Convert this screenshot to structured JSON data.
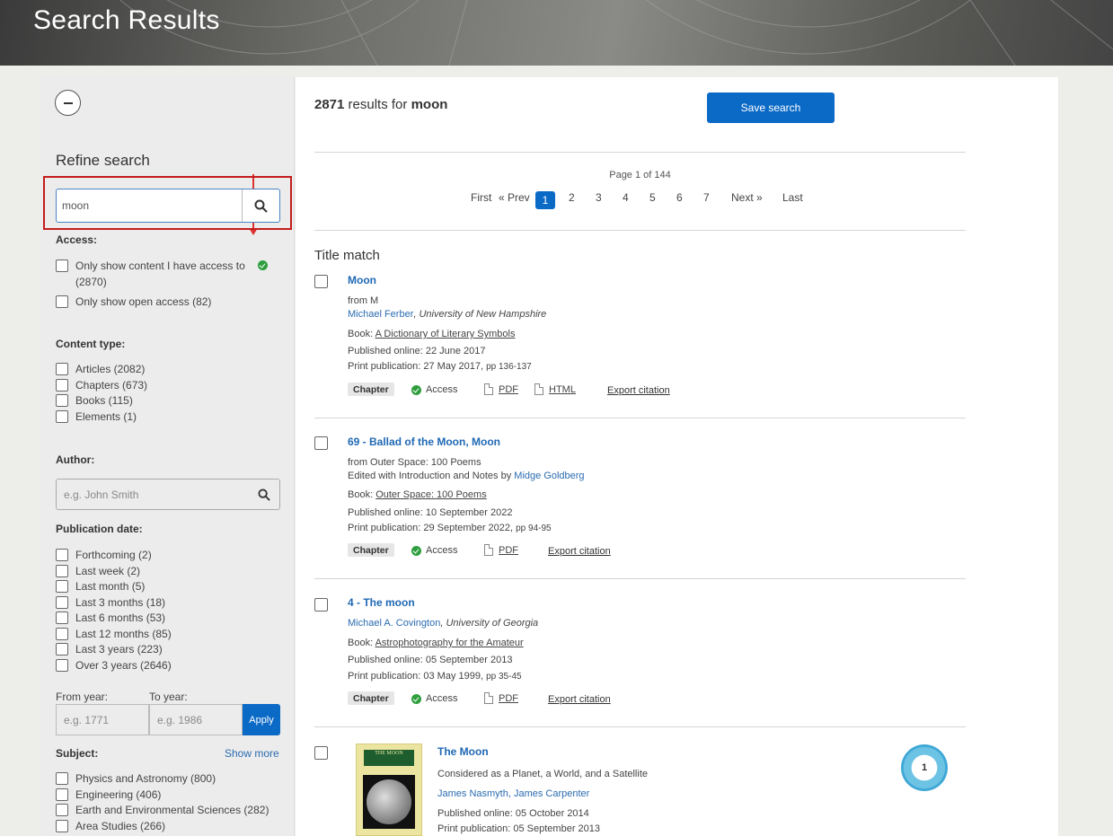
{
  "header": {
    "title": "Search Results"
  },
  "sidebar": {
    "refine_title": "Refine search",
    "search_value": "moon",
    "access": {
      "label": "Access:",
      "options": [
        "Only show content I have access to",
        "(2870)",
        "Only show open access (82)"
      ]
    },
    "content_type": {
      "label": "Content type:",
      "options": [
        "Articles (2082)",
        "Chapters (673)",
        "Books (115)",
        "Elements (1)"
      ]
    },
    "author": {
      "label": "Author:",
      "placeholder": "e.g. John Smith"
    },
    "publication_date": {
      "label": "Publication date:",
      "options": [
        "Forthcoming (2)",
        "Last week (2)",
        "Last month (5)",
        "Last 3 months (18)",
        "Last 6 months (53)",
        "Last 12 months (85)",
        "Last 3 years (223)",
        "Over 3 years (2646)"
      ]
    },
    "from_year": {
      "label": "From year:",
      "placeholder": "e.g. 1771"
    },
    "to_year": {
      "label": "To year:",
      "placeholder": "e.g. 1986"
    },
    "apply_label": "Apply",
    "subject": {
      "label": "Subject:",
      "show_more": "Show more",
      "options": [
        "Physics and Astronomy (800)",
        "Engineering (406)",
        "Earth and Environmental Sciences (282)",
        "Area Studies (266)"
      ]
    }
  },
  "main": {
    "count": "2871",
    "results_for": "results for",
    "query": "moon",
    "save_label": "Save search",
    "page_of": "Page 1 of 144",
    "pager": {
      "first": "First",
      "prev": "« Prev",
      "pages": [
        "1",
        "2",
        "3",
        "4",
        "5",
        "6",
        "7"
      ],
      "next": "Next »",
      "last": "Last"
    },
    "section_title": "Title match",
    "results": [
      {
        "title": "Moon",
        "from": "from M",
        "author": "Michael Ferber",
        "affiliation": ", University of New Hampshire",
        "book_prefix": "Book: ",
        "book": "A Dictionary of Literary Symbols",
        "published": "Published online: 22 June 2017",
        "print": "Print publication: 27 May 2017, ",
        "pages": "pp 136-137",
        "badge": "Chapter",
        "access": "Access",
        "pdf": "PDF",
        "html": "HTML",
        "export": "Export citation"
      },
      {
        "title": "69 - Ballad of the Moon, Moon",
        "from": "from Outer Space: 100 Poems",
        "edited": "Edited with Introduction and Notes by ",
        "editor": "Midge Goldberg",
        "book_prefix": "Book: ",
        "book": "Outer Space: 100 Poems",
        "published": "Published online: 10 September 2022",
        "print": "Print publication: 29 September 2022, ",
        "pages": "pp 94-95",
        "badge": "Chapter",
        "access": "Access",
        "pdf": "PDF",
        "export": "Export citation"
      },
      {
        "title": "4 - The moon",
        "author": "Michael A. Covington",
        "affiliation": ", University of Georgia",
        "book_prefix": "Book: ",
        "book": "Astrophotography for the Amateur",
        "published": "Published online: 05 September 2013",
        "print": "Print publication: 03 May 1999, ",
        "pages": "pp 35-45",
        "badge": "Chapter",
        "access": "Access",
        "pdf": "PDF",
        "export": "Export citation"
      },
      {
        "title": "The Moon",
        "subtitle": "Considered as a Planet, a World, and a Satellite",
        "authors": "James Nasmyth, James Carpenter",
        "published": "Published online: 05 October 2014",
        "print": "Print publication: 05 September 2013",
        "cover_text": "THE MOON",
        "altmetric": "1"
      }
    ]
  },
  "colors": {
    "accent": "#0c6ac7",
    "link": "#1f68b4",
    "highlight": "#c41d1d",
    "access_green": "#2e9e3e"
  }
}
